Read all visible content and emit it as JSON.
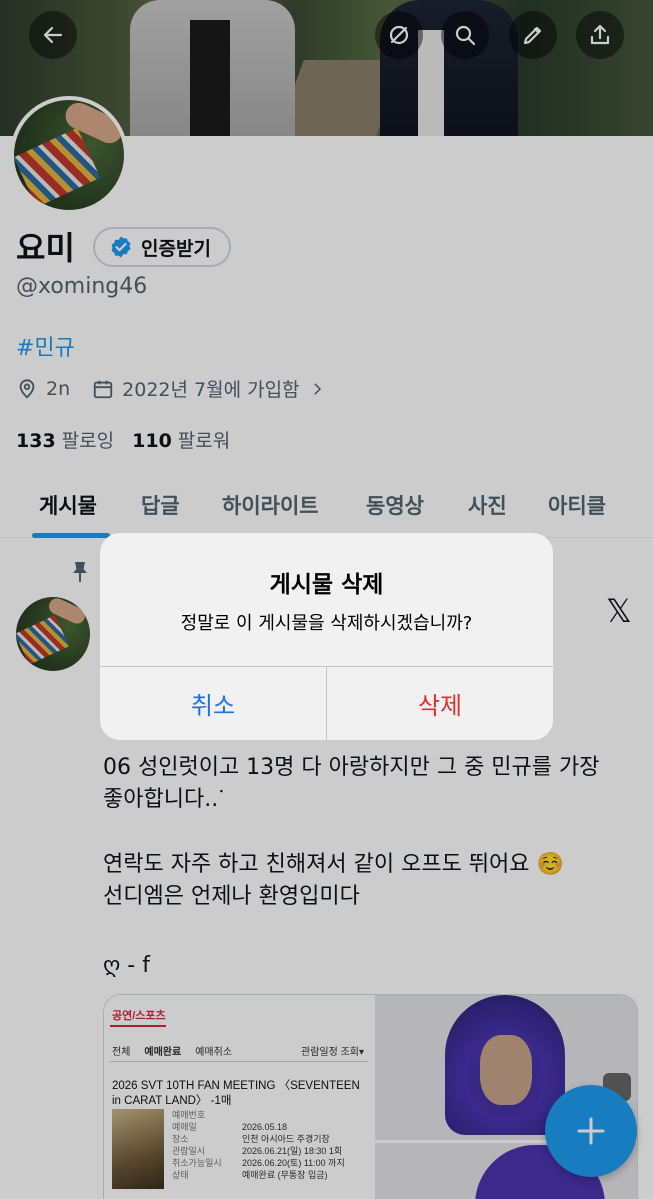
{
  "profile": {
    "name": "요미",
    "verify_label": "인증받기",
    "handle": "@xoming46",
    "bio": "#민규",
    "location": "2n",
    "joined": "2022년 7월에 가입함",
    "following_count": "133",
    "following_label": "팔로잉",
    "followers_count": "110",
    "followers_label": "팔로워"
  },
  "tabs": [
    "게시물",
    "답글",
    "하이라이트",
    "동영상",
    "사진",
    "아티클"
  ],
  "post": {
    "line1": "06 성인럿이고 13명 다 아랑하지만 그 중 민규를 가장\n좋아합니다..ᐝ",
    "line2": "연락도 자주 하고 친해져서 같이 오프도 뛰어요 ☺️\n선디엠은 언제나 환영입미다",
    "line3": "ღ - f"
  },
  "ticket": {
    "category": "공연/스포츠",
    "tabs": [
      "전체",
      "예매완료",
      "예매취소"
    ],
    "sort_label": "관람일정 조회▾",
    "title": "2026 SVT 10TH FAN MEETING 〈SEVENTEEN in CARAT LAND〉 -1매",
    "rows": [
      {
        "k": "예매번호",
        "v": ""
      },
      {
        "k": "예매일",
        "v": "2026.05.18"
      },
      {
        "k": "장소",
        "v": "인천 아시아드 주경기장"
      },
      {
        "k": "관람일시",
        "v": "2026.06.21(일) 18:30 1회"
      },
      {
        "k": "취소가능일시",
        "v": "2026.06.20(토) 11:00 까지"
      },
      {
        "k": "상태",
        "v": "예매완료 (무통장 입금)"
      }
    ]
  },
  "dialog": {
    "title": "게시물 삭제",
    "message": "정말로 이 게시물을 삭제하시겠습니까?",
    "cancel": "취소",
    "delete": "삭제"
  },
  "colors": {
    "accent": "#1d9bf0",
    "cancel": "#1a73e8",
    "destructive": "#e0302a"
  }
}
